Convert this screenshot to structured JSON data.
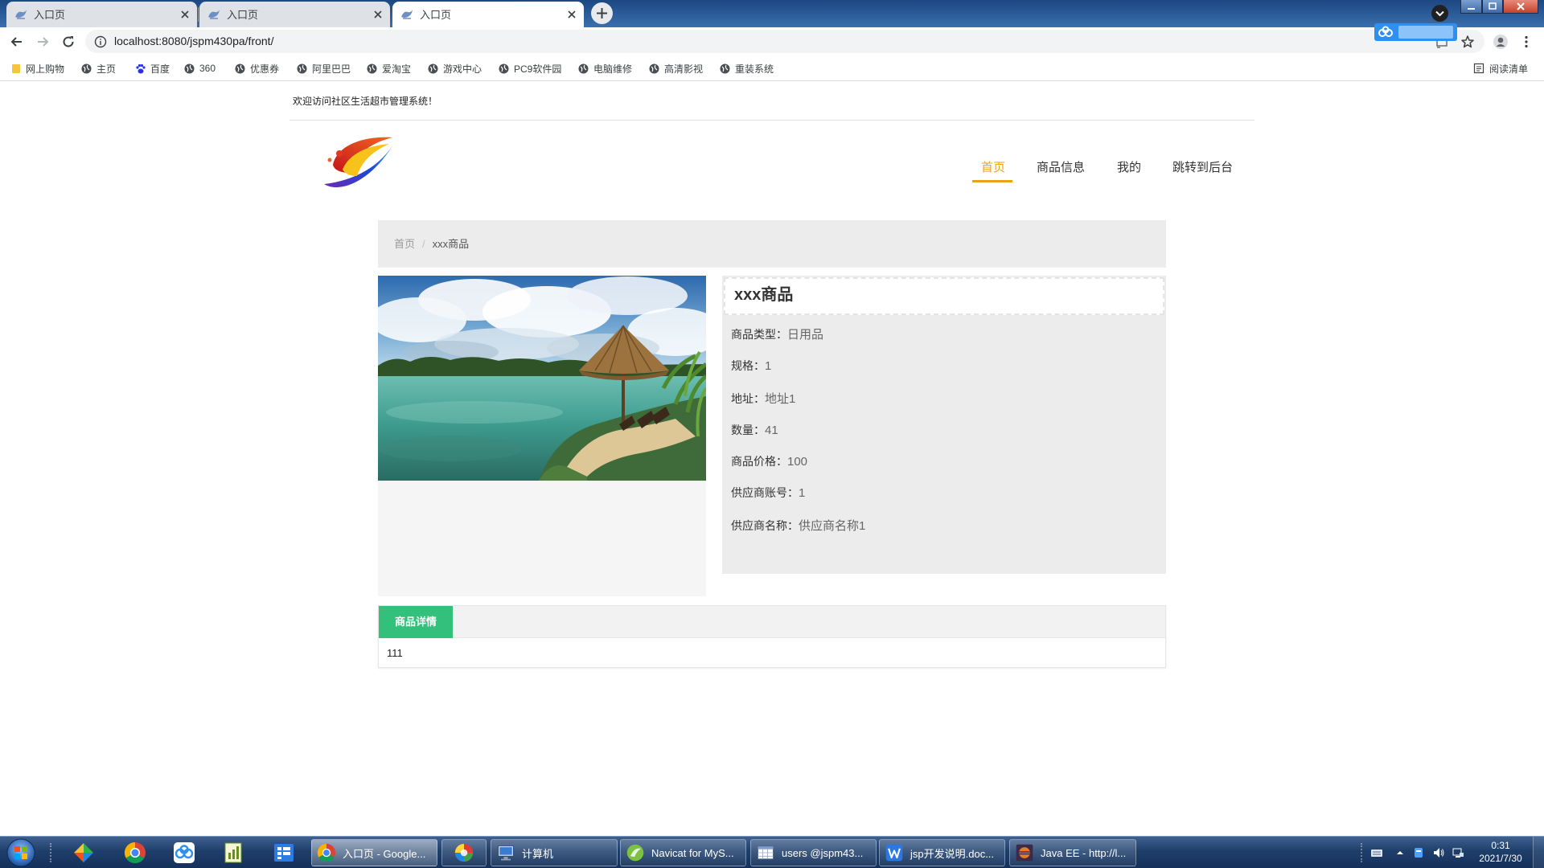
{
  "browser": {
    "tabs": [
      {
        "title": "入口页"
      },
      {
        "title": "入口页"
      },
      {
        "title": "入口页",
        "active": true
      }
    ],
    "url": "localhost:8080/jspm430pa/front/",
    "bookmarks": [
      {
        "label": "网上购物",
        "icon": "folder-icon"
      },
      {
        "label": "主页",
        "icon": "globe-icon"
      },
      {
        "label": "百度",
        "icon": "baidu-paw-icon"
      },
      {
        "label": "360",
        "icon": "globe-icon"
      },
      {
        "label": "优惠券",
        "icon": "globe-icon"
      },
      {
        "label": "阿里巴巴",
        "icon": "globe-icon"
      },
      {
        "label": "爱淘宝",
        "icon": "globe-icon"
      },
      {
        "label": "游戏中心",
        "icon": "globe-icon"
      },
      {
        "label": "PC9软件园",
        "icon": "globe-icon"
      },
      {
        "label": "电脑维修",
        "icon": "globe-icon"
      },
      {
        "label": "高清影视",
        "icon": "globe-icon"
      },
      {
        "label": "重装系统",
        "icon": "globe-icon"
      }
    ],
    "reading_list": "阅读清单"
  },
  "site": {
    "welcome": "欢迎访问社区生活超市管理系统！",
    "nav": [
      {
        "label": "首页",
        "active": true
      },
      {
        "label": "商品信息"
      },
      {
        "label": "我的"
      },
      {
        "label": "跳转到后台"
      }
    ]
  },
  "breadcrumb": {
    "home": "首页",
    "separator": "/",
    "current": "xxx商品"
  },
  "product": {
    "name": "xxx商品",
    "fields": [
      {
        "label": "商品类型：",
        "value": "日用品"
      },
      {
        "label": "规格：",
        "value": "1"
      },
      {
        "label": "地址：",
        "value": "地址1"
      },
      {
        "label": "数量：",
        "value": "41"
      },
      {
        "label": "商品价格：",
        "value": "100"
      },
      {
        "label": "供应商账号：",
        "value": "1"
      },
      {
        "label": "供应商名称：",
        "value": "供应商名称1"
      }
    ]
  },
  "detail_tab": {
    "label": "商品详情",
    "content": "111"
  },
  "taskbar": {
    "windows": [
      {
        "label": "入口页 - Google...",
        "icon": "chrome-icon",
        "active": true
      },
      {
        "label": "计算机",
        "icon": "computer-icon"
      },
      {
        "label": "Navicat for MyS...",
        "icon": "navicat-icon"
      },
      {
        "label": "users @jspm43...",
        "icon": "table-icon"
      },
      {
        "label": "jsp开发说明.doc...",
        "icon": "wps-writer-icon"
      },
      {
        "label": "Java EE - http://l...",
        "icon": "eclipse-icon"
      }
    ],
    "clock": {
      "time": "0:31",
      "date": "2021/7/30"
    }
  },
  "colors": {
    "nav_active": "#e8a317",
    "tab_green": "#33c07a",
    "panel_bg": "#ececec",
    "taskbar": "#1f3f6b"
  }
}
